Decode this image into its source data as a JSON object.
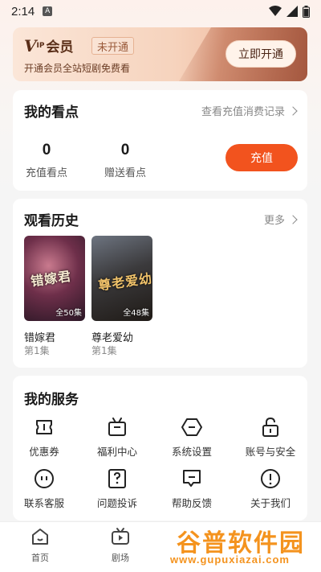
{
  "status": {
    "time": "2:14",
    "badge": "A"
  },
  "vip": {
    "logo_v": "V",
    "logo_ip": "IP",
    "logo_text": "会员",
    "status_tag": "未开通",
    "subtitle": "开通会员全站短剧免费看",
    "action": "立即开通",
    "colors": {
      "card": "#f6d3bd",
      "text": "#5a2e18"
    }
  },
  "points": {
    "title": "我的看点",
    "link": "查看充值消费记录",
    "recharge": {
      "value": "0",
      "label": "充值看点"
    },
    "gift": {
      "value": "0",
      "label": "赠送看点"
    },
    "button": "充值",
    "accent": "#f2531e"
  },
  "history": {
    "title": "观看历史",
    "more": "更多",
    "items": [
      {
        "poster_title": "错嫁君",
        "episodes": "全50集",
        "name": "错嫁君",
        "progress": "第1集"
      },
      {
        "poster_title": "尊老爱幼",
        "episodes": "全48集",
        "name": "尊老爱幼",
        "progress": "第1集"
      }
    ]
  },
  "services": {
    "title": "我的服务",
    "items": [
      {
        "label": "优惠券",
        "icon": "ticket-icon"
      },
      {
        "label": "福利中心",
        "icon": "gift-box-icon"
      },
      {
        "label": "系统设置",
        "icon": "hexagon-settings-icon"
      },
      {
        "label": "账号与安全",
        "icon": "lock-icon"
      },
      {
        "label": "联系客服",
        "icon": "chat-icon"
      },
      {
        "label": "问题投诉",
        "icon": "question-icon"
      },
      {
        "label": "帮助反馈",
        "icon": "feedback-icon"
      },
      {
        "label": "关于我们",
        "icon": "info-icon"
      }
    ]
  },
  "tabbar": {
    "items": [
      {
        "label": "首页",
        "icon": "home-icon"
      },
      {
        "label": "剧场",
        "icon": "tv-icon"
      }
    ]
  },
  "watermark": {
    "text": "谷普软件园",
    "url": "www.gupuxiazai.com"
  }
}
